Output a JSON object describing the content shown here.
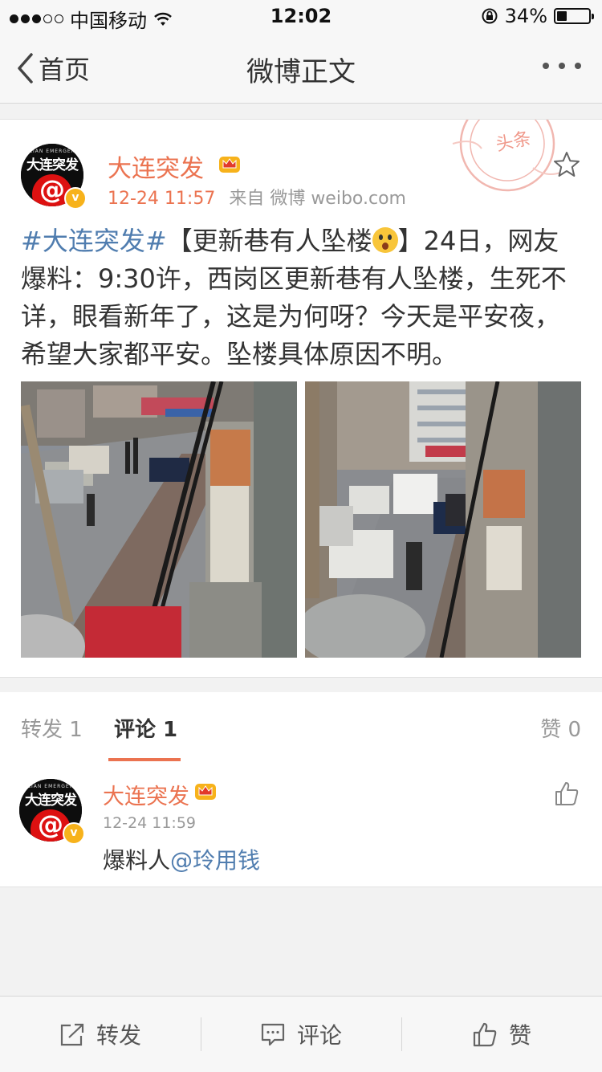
{
  "status_bar": {
    "carrier": "中国移动",
    "time": "12:02",
    "battery_percent": "34%",
    "battery_level": 0.34,
    "signal_bars": 3,
    "signal_total": 5
  },
  "nav": {
    "back_label": "首页",
    "title": "微博正文"
  },
  "post": {
    "author": "大连突发",
    "avatar_text": "大连突发",
    "avatar_top_text": "DALIAN EMERGENCY",
    "avatar_symbol": "@",
    "verified_badge": "v",
    "time": "12-24 11:57",
    "source": "来自 微博 weibo.com",
    "stamp_text": "头条",
    "topic": "#大连突发#",
    "headline_open": "【更新巷有人坠楼",
    "headline_close": "】",
    "body": "24日，网友爆料：9:30许，西岗区更新巷有人坠楼，生死不详，眼看新年了，这是为何呀？今天是平安夜，希望大家都平安。坠楼具体原因不明。"
  },
  "tabs": {
    "repost": "转发 1",
    "comment": "评论 1",
    "like": "赞 0"
  },
  "comment": {
    "author": "大连突发",
    "time": "12-24 11:59",
    "text_prefix": "爆料人",
    "mention": "@玲用钱"
  },
  "toolbar": {
    "repost": "转发",
    "comment": "评论",
    "like": "赞"
  },
  "colors": {
    "accent": "#eb7350",
    "link": "#507daf",
    "verified": "#f7b21b"
  }
}
